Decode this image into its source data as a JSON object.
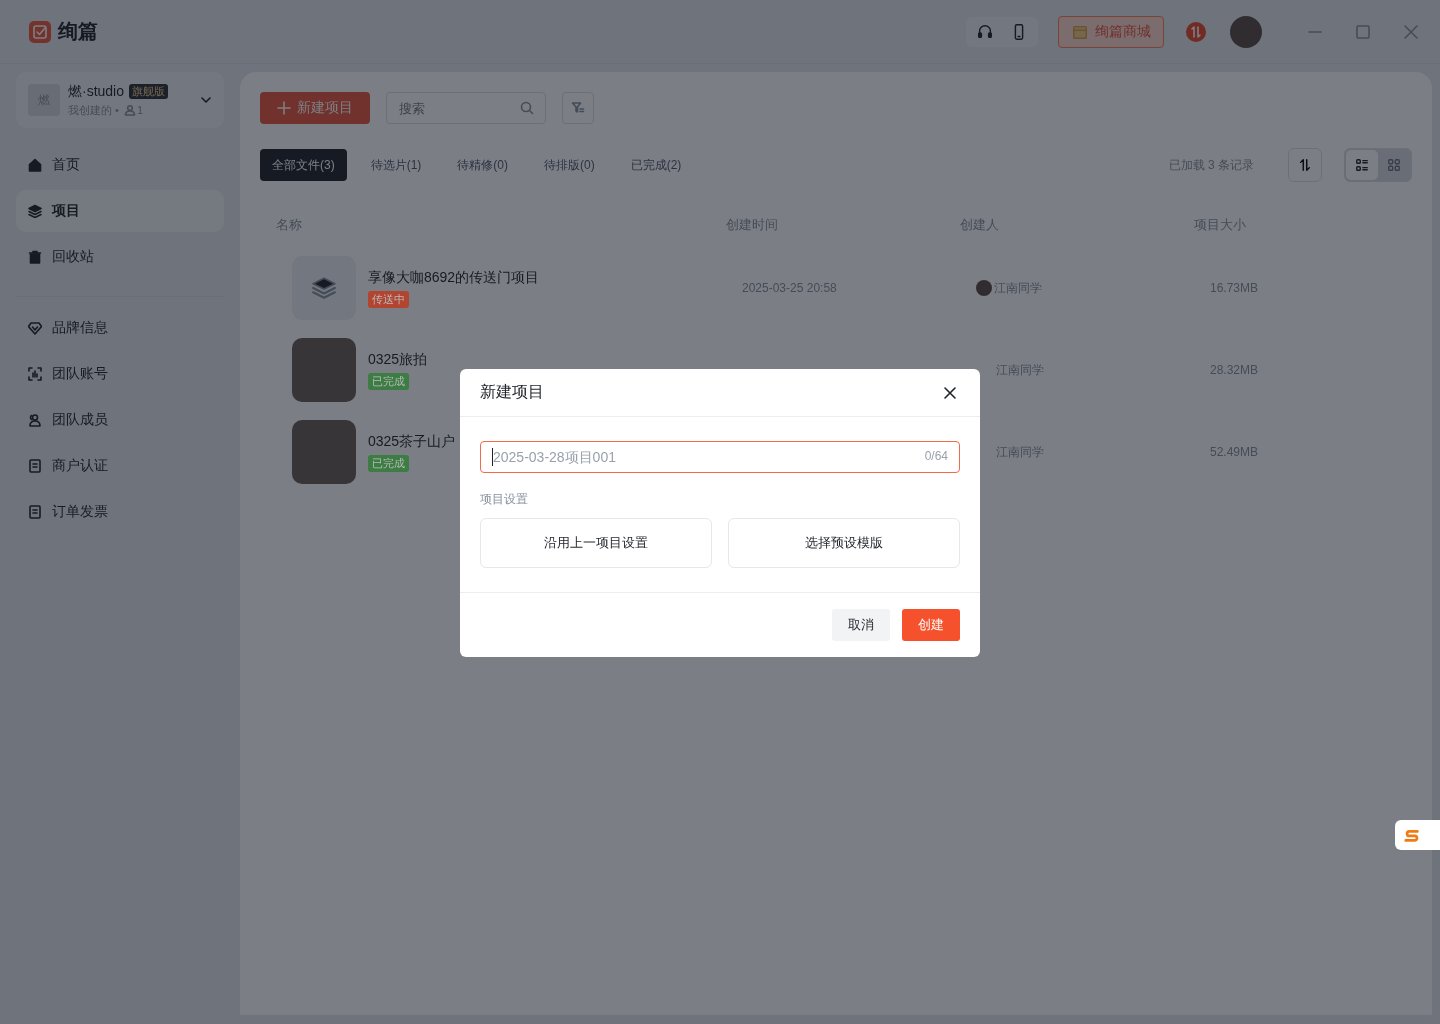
{
  "app": {
    "title": "绚篇"
  },
  "topbar": {
    "store_button": "绚篇商城"
  },
  "workspace": {
    "avatar_text": "燃",
    "name": "燃·studio",
    "plan": "旗舰版",
    "subtitle": "我创建的 •",
    "member_count": "1"
  },
  "sidebar": {
    "main_items": [
      {
        "label": "首页",
        "selected": false
      },
      {
        "label": "项目",
        "selected": true
      },
      {
        "label": "回收站",
        "selected": false
      }
    ],
    "settings_items": [
      {
        "label": "品牌信息",
        "selected": false
      },
      {
        "label": "团队账号",
        "selected": false
      },
      {
        "label": "团队成员",
        "selected": false
      },
      {
        "label": "商户认证",
        "selected": false
      },
      {
        "label": "订单发票",
        "selected": false
      }
    ]
  },
  "toolbar": {
    "new_button": "新建项目",
    "search_placeholder": "搜索"
  },
  "tabs": [
    {
      "label": "全部文件(3)",
      "selected": true
    },
    {
      "label": "待选片(1)",
      "selected": false
    },
    {
      "label": "待精修(0)",
      "selected": false
    },
    {
      "label": "待排版(0)",
      "selected": false
    },
    {
      "label": "已完成(2)",
      "selected": false
    }
  ],
  "record_count": "已加载 3 条记录",
  "view_modes": [
    {
      "selected": true
    },
    {
      "selected": false
    }
  ],
  "table": {
    "columns": [
      "名称",
      "创建时间",
      "创建人",
      "项目大小"
    ],
    "rows": [
      {
        "kind": "project",
        "name": "享像大咖8692的传送门项目",
        "status": {
          "label": "传送中",
          "color": "#b2452f"
        },
        "created": "2025-03-25 20:58",
        "creator_avatar": true,
        "creator": "江南同学",
        "size": "16.73MB"
      },
      {
        "kind": "photo",
        "name": "0325旅拍",
        "status": {
          "label": "已完成",
          "color": "#3d7c42"
        },
        "creator_avatar": false,
        "creator": "江南同学",
        "size": "28.32MB"
      },
      {
        "kind": "photo",
        "name": "0325茶子山户",
        "status": {
          "label": "已完成",
          "color": "#3d7c42"
        },
        "creator_avatar": false,
        "creator": "江南同学",
        "size": "52.49MB"
      }
    ]
  },
  "dialog": {
    "title": "新建项目",
    "input": {
      "placeholder": "2025-03-28项目001",
      "counter": "0/64",
      "focused": true
    },
    "section_label": "项目设置",
    "options": [
      "沿用上一项目设置",
      "选择预设模版"
    ],
    "buttons": [
      {
        "label": "取消",
        "kind": "secondary"
      },
      {
        "label": "创建",
        "kind": "primary"
      }
    ]
  }
}
